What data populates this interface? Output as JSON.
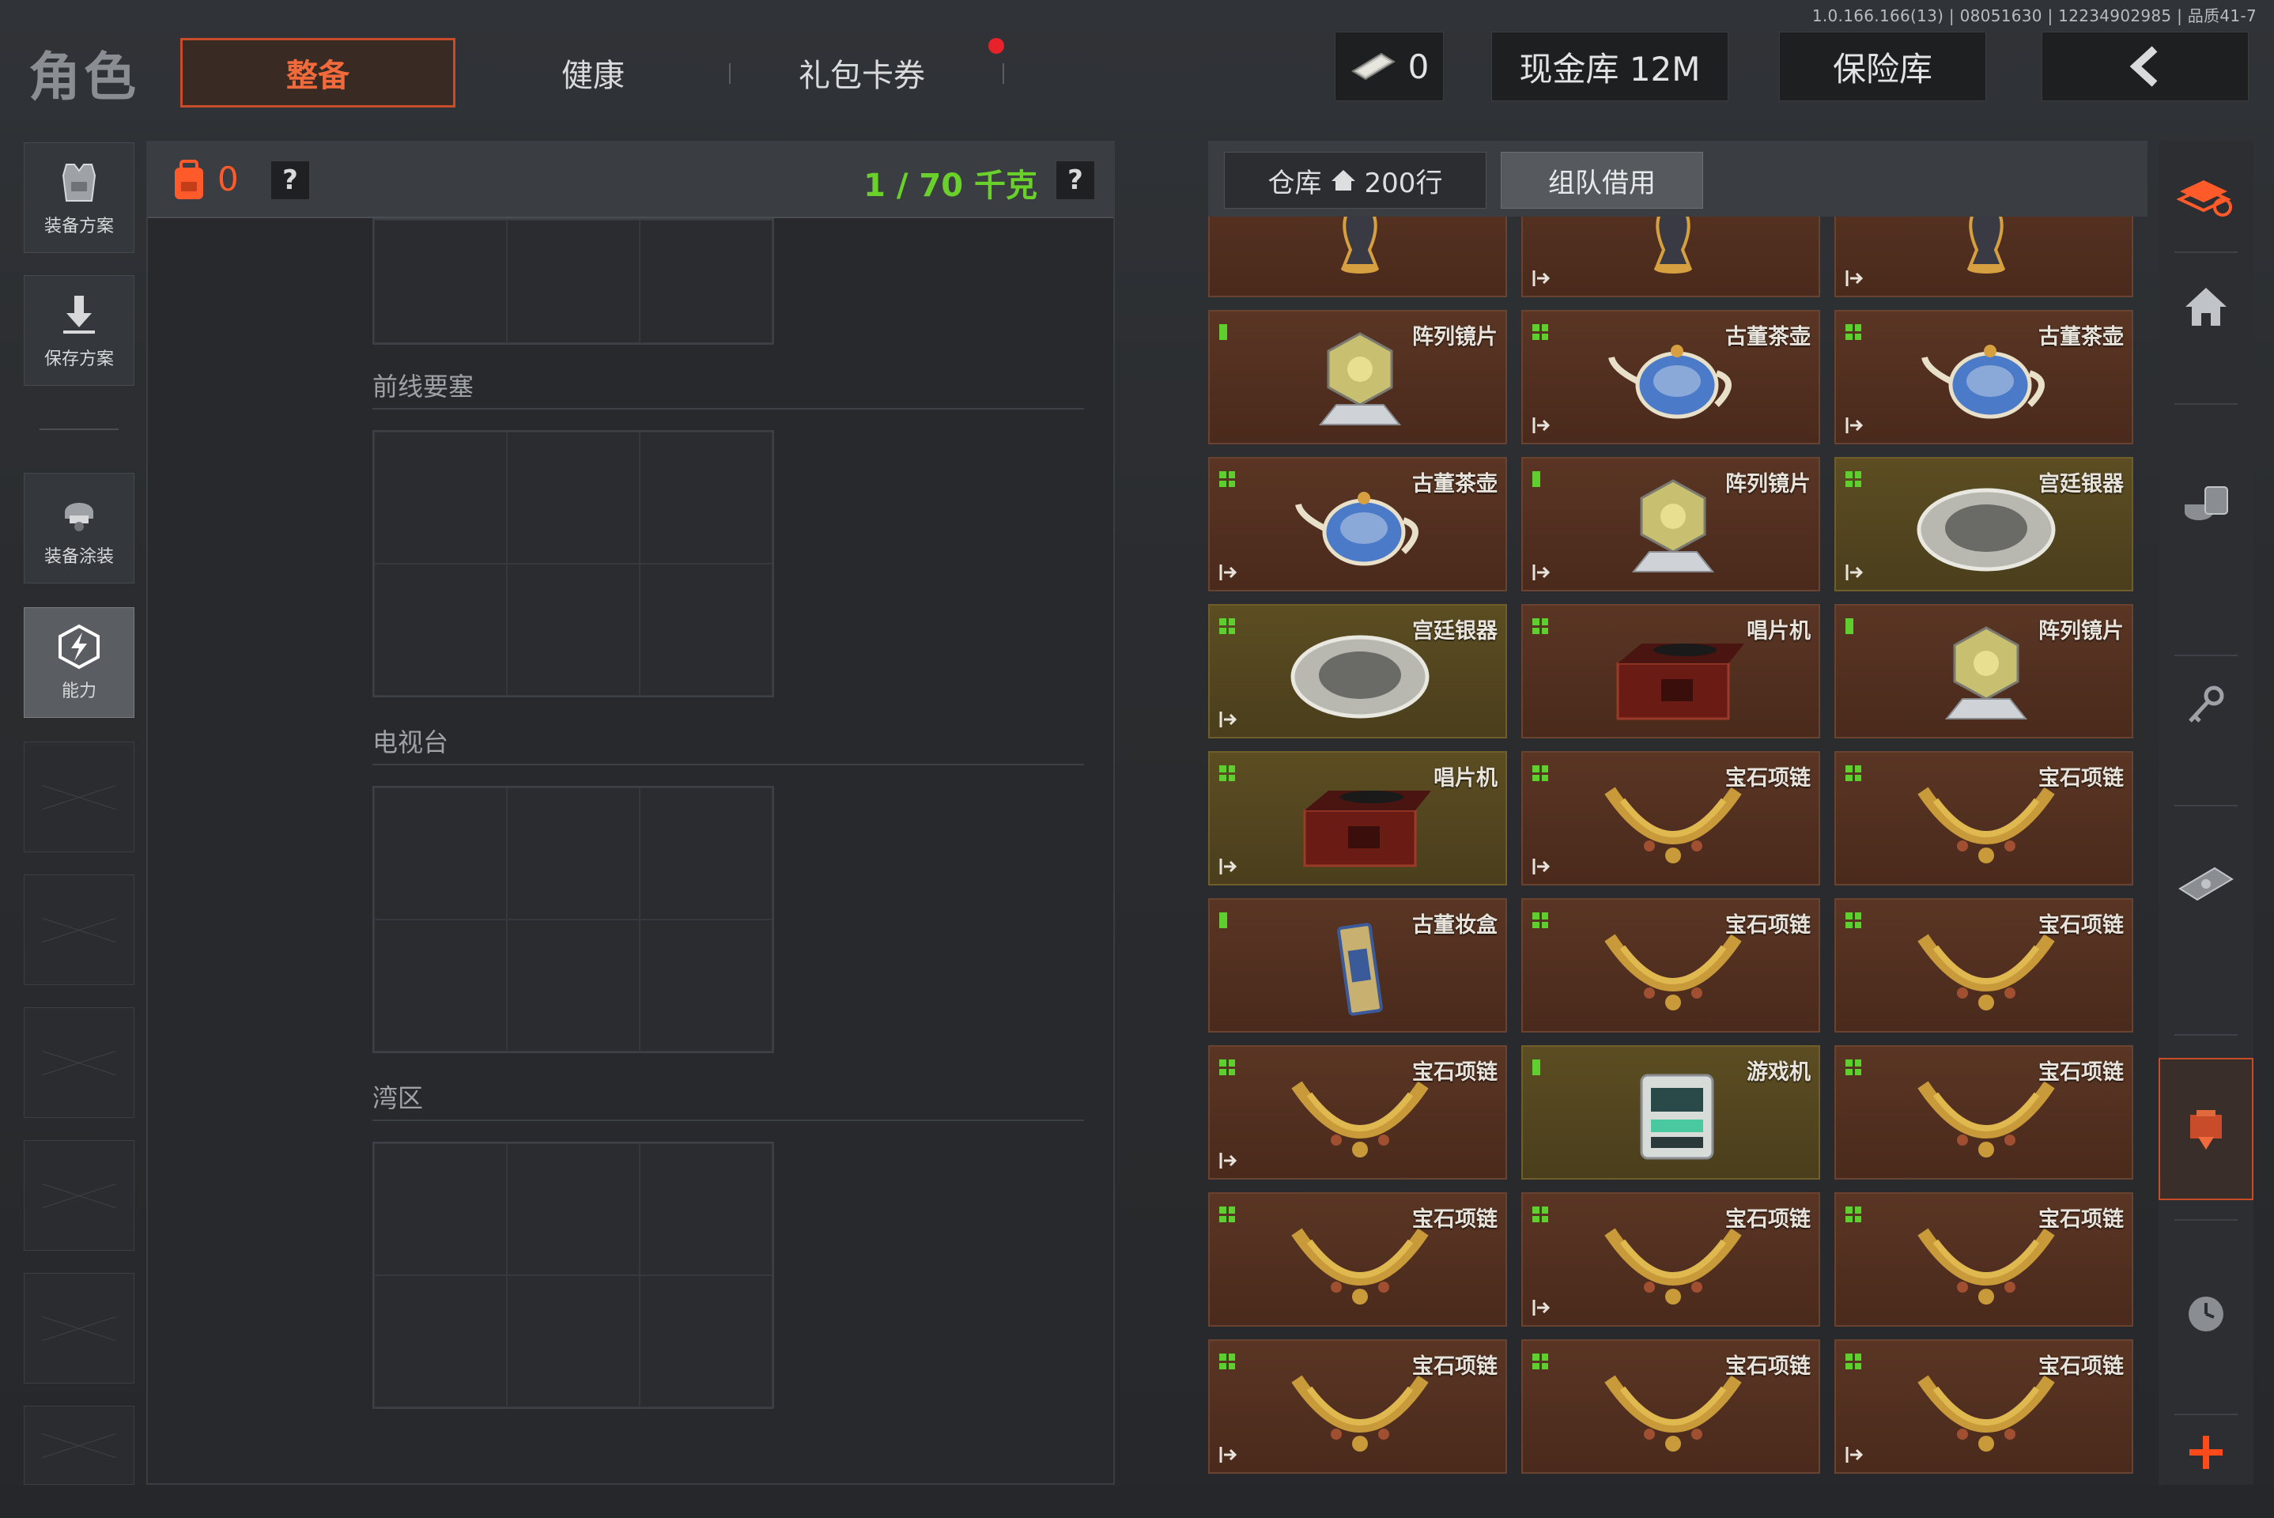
{
  "version": "1.0.166.166(13) | 08051630 | 12234902985 | 品质41-7",
  "header": {
    "title": "角色",
    "tabs": [
      {
        "label": "整备",
        "active": true
      },
      {
        "label": "健康",
        "active": false
      },
      {
        "label": "礼包卡券",
        "active": false
      }
    ],
    "ticket_count": "0",
    "vault_label": "现金库 12M",
    "safe_label": "保险库"
  },
  "left_nav": [
    {
      "label": "装备方案",
      "icon": "vest-icon"
    },
    {
      "label": "保存方案",
      "icon": "download-icon"
    },
    {
      "label": "装备涂装",
      "icon": "helmet-icon"
    },
    {
      "label": "能力",
      "icon": "lightning-icon",
      "active": true
    }
  ],
  "loadout": {
    "bag_count": "0",
    "help": "?",
    "weight": "1 / 70 千克",
    "sections": [
      {
        "title": "前线要塞"
      },
      {
        "title": "电视台"
      },
      {
        "title": "湾区"
      }
    ]
  },
  "storage": {
    "tab_storage": "仓库",
    "tab_storage_rows": "200行",
    "tab_team": "组队借用",
    "items": [
      {
        "name": "",
        "icon": "vase-icon",
        "theme": "red",
        "size": "",
        "exit": false
      },
      {
        "name": "",
        "icon": "vase-icon",
        "theme": "red",
        "size": "",
        "exit": true
      },
      {
        "name": "",
        "icon": "vase-icon",
        "theme": "red",
        "size": "",
        "exit": true
      },
      {
        "name": "阵列镜片",
        "icon": "lens-icon",
        "theme": "red",
        "size": "single",
        "exit": false
      },
      {
        "name": "古董茶壶",
        "icon": "teapot-icon",
        "theme": "red",
        "size": "quad",
        "exit": true
      },
      {
        "name": "古董茶壶",
        "icon": "teapot-icon",
        "theme": "red",
        "size": "quad",
        "exit": true
      },
      {
        "name": "古董茶壶",
        "icon": "teapot-icon",
        "theme": "red",
        "size": "quad",
        "exit": true
      },
      {
        "name": "阵列镜片",
        "icon": "lens-icon",
        "theme": "red",
        "size": "single",
        "exit": true
      },
      {
        "name": "宫廷银器",
        "icon": "silver-plate-icon",
        "theme": "gold",
        "size": "quad",
        "exit": true
      },
      {
        "name": "宫廷银器",
        "icon": "silver-plate-icon",
        "theme": "gold",
        "size": "quad",
        "exit": true
      },
      {
        "name": "唱片机",
        "icon": "gramophone-icon",
        "theme": "red",
        "size": "quad",
        "exit": false
      },
      {
        "name": "阵列镜片",
        "icon": "lens-icon",
        "theme": "red",
        "size": "single",
        "exit": false
      },
      {
        "name": "唱片机",
        "icon": "gramophone-icon",
        "theme": "gold",
        "size": "quad",
        "exit": true
      },
      {
        "name": "宝石项链",
        "icon": "necklace-icon",
        "theme": "red",
        "size": "quad",
        "exit": true
      },
      {
        "name": "宝石项链",
        "icon": "necklace-icon",
        "theme": "red",
        "size": "quad",
        "exit": false
      },
      {
        "name": "古董妆盒",
        "icon": "vanity-box-icon",
        "theme": "red",
        "size": "single",
        "exit": false
      },
      {
        "name": "宝石项链",
        "icon": "necklace-icon",
        "theme": "red",
        "size": "quad",
        "exit": false
      },
      {
        "name": "宝石项链",
        "icon": "necklace-icon",
        "theme": "red",
        "size": "quad",
        "exit": false
      },
      {
        "name": "宝石项链",
        "icon": "necklace-icon",
        "theme": "red",
        "size": "quad",
        "exit": true
      },
      {
        "name": "游戏机",
        "icon": "arcade-icon",
        "theme": "gold",
        "size": "single",
        "exit": false
      },
      {
        "name": "宝石项链",
        "icon": "necklace-icon",
        "theme": "red",
        "size": "quad",
        "exit": false
      },
      {
        "name": "宝石项链",
        "icon": "necklace-icon",
        "theme": "red",
        "size": "quad",
        "exit": false
      },
      {
        "name": "宝石项链",
        "icon": "necklace-icon",
        "theme": "red",
        "size": "quad",
        "exit": true
      },
      {
        "name": "宝石项链",
        "icon": "necklace-icon",
        "theme": "red",
        "size": "quad",
        "exit": false
      },
      {
        "name": "宝石项链",
        "icon": "necklace-icon",
        "theme": "red",
        "size": "quad",
        "exit": true
      },
      {
        "name": "宝石项链",
        "icon": "necklace-icon",
        "theme": "red",
        "size": "quad",
        "exit": false
      },
      {
        "name": "宝石项链",
        "icon": "necklace-icon",
        "theme": "red",
        "size": "quad",
        "exit": true
      }
    ]
  },
  "right_sidebar": [
    {
      "icon": "stack-refresh-icon"
    },
    {
      "icon": "home-icon"
    },
    {
      "icon": "coins-icon"
    },
    {
      "icon": "key-icon"
    },
    {
      "icon": "cash-icon"
    },
    {
      "icon": "box-download-icon",
      "active": true
    },
    {
      "icon": "clock-icon"
    },
    {
      "icon": "plus-icon"
    }
  ],
  "colors": {
    "accent": "#f06a3c",
    "weight_green": "#6ad12a",
    "item_red": "#5a3524",
    "item_gold": "#5c4d22"
  }
}
